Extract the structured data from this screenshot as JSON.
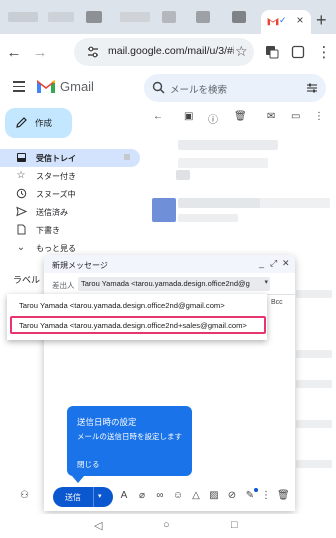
{
  "browser": {
    "url": "mail.google.com/mail/u/3/#i"
  },
  "app": {
    "name": "Gmail",
    "search_placeholder": "メールを検索"
  },
  "sidebar": {
    "compose_label": "作成",
    "items": [
      {
        "label": "受信トレイ",
        "icon": "inbox-icon",
        "active": true
      },
      {
        "label": "スター付き",
        "icon": "star-icon",
        "active": false
      },
      {
        "label": "スヌーズ中",
        "icon": "clock-icon",
        "active": false
      },
      {
        "label": "送信済み",
        "icon": "send-icon",
        "active": false
      },
      {
        "label": "下書き",
        "icon": "draft-icon",
        "active": false
      },
      {
        "label": "もっと見る",
        "icon": "chevron-down-icon",
        "active": false
      }
    ],
    "labels_heading": "ラベル"
  },
  "compose": {
    "title": "新規メッセージ",
    "from_label": "差出人",
    "from_value": "Tarou Yamada <tarou.yamada.design.office2nd@g",
    "bcc": "Bcc",
    "from_options": [
      "Tarou Yamada <tarou.yamada.design.office2nd@gmail.com>",
      "Tarou Yamada <tarou.yamada.design.office2nd+sales@gmail.com>"
    ],
    "send_label": "送信"
  },
  "tooltip": {
    "title": "送信日時の設定",
    "body": "メールの送信日時を設定します",
    "close": "閉じる"
  },
  "colors": {
    "accent": "#0b57d0",
    "tooltip_bg": "#1a73e8",
    "highlight": "#e8356e",
    "compose_btn": "#c2e7ff",
    "active_nav": "#d3e3fd"
  }
}
